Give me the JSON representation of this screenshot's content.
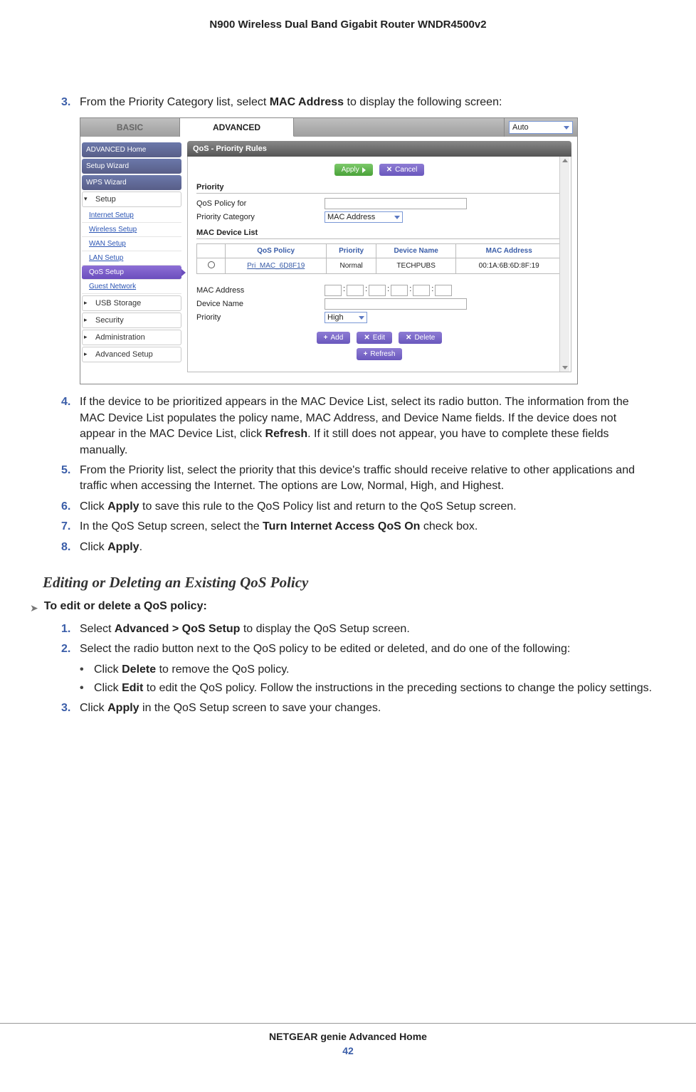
{
  "docTitle": "N900 Wireless Dual Band Gigabit Router WNDR4500v2",
  "step3": {
    "pre": "From the Priority Category list, select ",
    "b": "MAC Address",
    "post": " to display the following screen:"
  },
  "shot": {
    "tabs": {
      "basic": "BASIC",
      "advanced": "ADVANCED",
      "auto": "Auto"
    },
    "sidebar": {
      "home": "ADVANCED Home",
      "wizard": "Setup Wizard",
      "wps": "WPS Wizard",
      "setup": "Setup",
      "subs": [
        "Internet Setup",
        "Wireless Setup",
        "WAN Setup",
        "LAN Setup",
        "QoS Setup",
        "Guest Network"
      ],
      "usb": "USB Storage",
      "security": "Security",
      "admin": "Administration",
      "advsetup": "Advanced Setup"
    },
    "panelTitle": "QoS - Priority Rules",
    "buttons": {
      "apply": "Apply",
      "cancel": "Cancel",
      "add": "Add",
      "edit": "Edit",
      "delete": "Delete",
      "refresh": "Refresh"
    },
    "priorityLabel": "Priority",
    "labels": {
      "policyFor": "QoS Policy for",
      "priorityCat": "Priority Category",
      "mac": "MAC Address",
      "deviceName": "Device Name",
      "priority": "Priority"
    },
    "priorityCatSel": "MAC Address",
    "prioritySel": "High",
    "macListLabel": "MAC Device List",
    "tableHeaders": {
      "blank": "#",
      "policy": "QoS Policy",
      "priority": "Priority",
      "devname": "Device Name",
      "mac": "MAC Address"
    },
    "row": {
      "policy": "Pri_MAC_6D8F19",
      "priority": "Normal",
      "dev": "TECHPUBS",
      "mac": "00:1A:6B:6D:8F:19"
    }
  },
  "step4": {
    "p1": "If the device to be prioritized appears in the MAC Device List, select its radio button. The information from the MAC Device List populates the policy name, MAC Address, and Device Name fields. If the device does not appear in the MAC Device List, click ",
    "b": "Refresh",
    "p2": ". If it still does not appear, you have to complete these fields manually."
  },
  "step5": "From the Priority list, select the priority that this device's traffic should receive relative to other applications and traffic when accessing the Internet. The options are Low, Normal, High, and Highest.",
  "step6": {
    "p1": "Click ",
    "b": "Apply",
    "p2": " to save this rule to the QoS Policy list and return to the QoS Setup screen."
  },
  "step7": {
    "p1": "In the QoS Setup screen, select the ",
    "b": "Turn Internet Access QoS On",
    "p2": " check box."
  },
  "step8": {
    "p1": "Click ",
    "b": "Apply",
    "p2": "."
  },
  "subHeading": "Editing or Deleting an Existing QoS Policy",
  "lead": "To edit or delete a QoS policy:",
  "s1": {
    "p1": "Select ",
    "b": "Advanced > QoS Setup",
    "p2": " to display the QoS Setup screen."
  },
  "s2": "Select the radio button next to the QoS policy to be edited or deleted, and do one of the following:",
  "bul1": {
    "p1": "Click ",
    "b": "Delete",
    "p2": " to remove the QoS policy."
  },
  "bul2": {
    "p1": "Click ",
    "b": "Edit",
    "p2": " to edit the QoS policy. Follow the instructions in the preceding sections to change the policy settings."
  },
  "s3": {
    "p1": "Click ",
    "b": "Apply",
    "p2": " in the QoS Setup screen to save your changes."
  },
  "footerLine": "NETGEAR genie Advanced Home",
  "footerPage": "42",
  "nums": {
    "n3": "3.",
    "n4": "4.",
    "n5": "5.",
    "n6": "6.",
    "n7": "7.",
    "n8": "8.",
    "n1": "1.",
    "n2": "2.",
    "n3b": "3."
  },
  "bulletDot": "•",
  "arrow": "➤"
}
